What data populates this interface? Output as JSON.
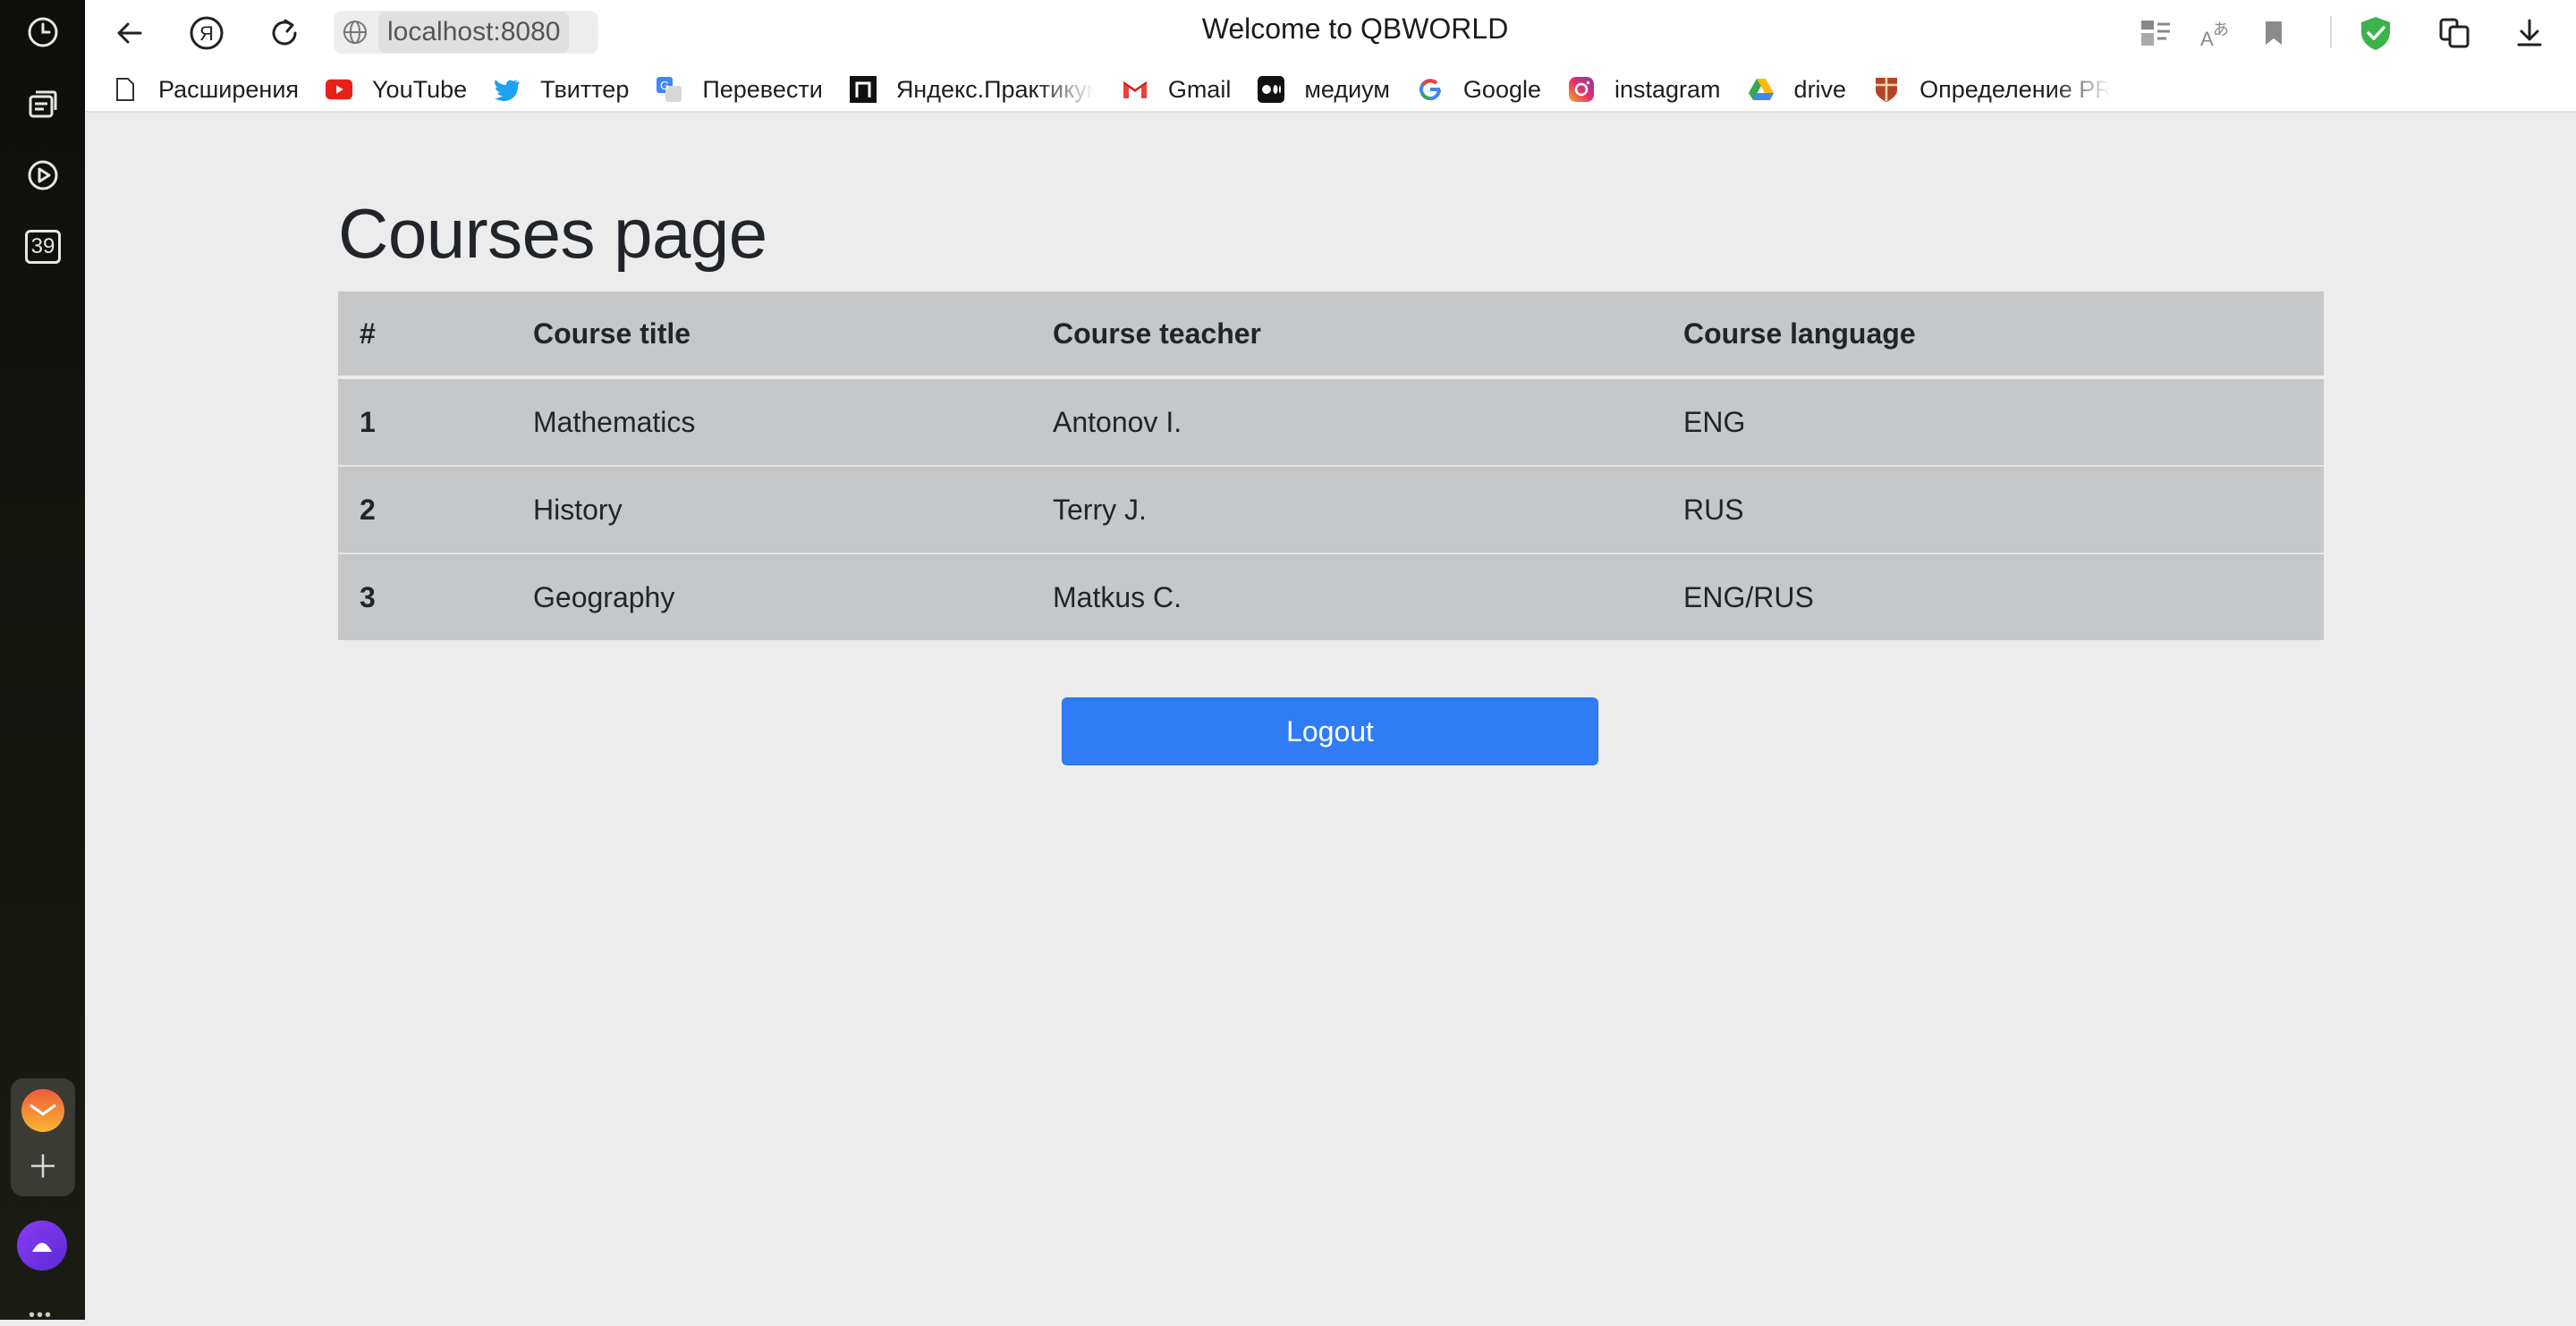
{
  "browser": {
    "url": "localhost:8080",
    "tab_title": "Welcome to QBWORLD"
  },
  "sidebar": {
    "counter_badge": "39",
    "icons": [
      "history-icon",
      "tabs-icon",
      "play-icon",
      "counter-badge",
      "mail-app-icon",
      "add-icon",
      "alice-assistant-icon"
    ]
  },
  "bookmarks": [
    {
      "label": "Расширения",
      "icon": "page-icon"
    },
    {
      "label": "YouTube",
      "icon": "youtube-icon"
    },
    {
      "label": "Твиттер",
      "icon": "twitter-icon"
    },
    {
      "label": "Перевести",
      "icon": "translate-icon"
    },
    {
      "label": "Яндекс.Практикум",
      "icon": "practicum-icon"
    },
    {
      "label": "Gmail",
      "icon": "gmail-icon"
    },
    {
      "label": "медиум",
      "icon": "medium-icon"
    },
    {
      "label": "Google",
      "icon": "google-icon"
    },
    {
      "label": "instagram",
      "icon": "instagram-icon"
    },
    {
      "label": "drive",
      "icon": "drive-icon"
    },
    {
      "label": "Определение PR",
      "icon": "cambridge-icon"
    }
  ],
  "main": {
    "heading": "Courses page",
    "table": {
      "headers": [
        "#",
        "Course title",
        "Course teacher",
        "Course language"
      ],
      "rows": [
        [
          "1",
          "Mathematics",
          "Antonov I.",
          "ENG"
        ],
        [
          "2",
          "History",
          "Terry J.",
          "RUS"
        ],
        [
          "3",
          "Geography",
          "Matkus C.",
          "ENG/RUS"
        ]
      ]
    },
    "logout_label": "Logout"
  },
  "colors": {
    "primary_button": "#2f7cf6",
    "table_bg": "#c6c7c9",
    "page_bg": "#ececec",
    "sidebar_bg": "#12130e",
    "shield_green": "#3cb24a"
  }
}
